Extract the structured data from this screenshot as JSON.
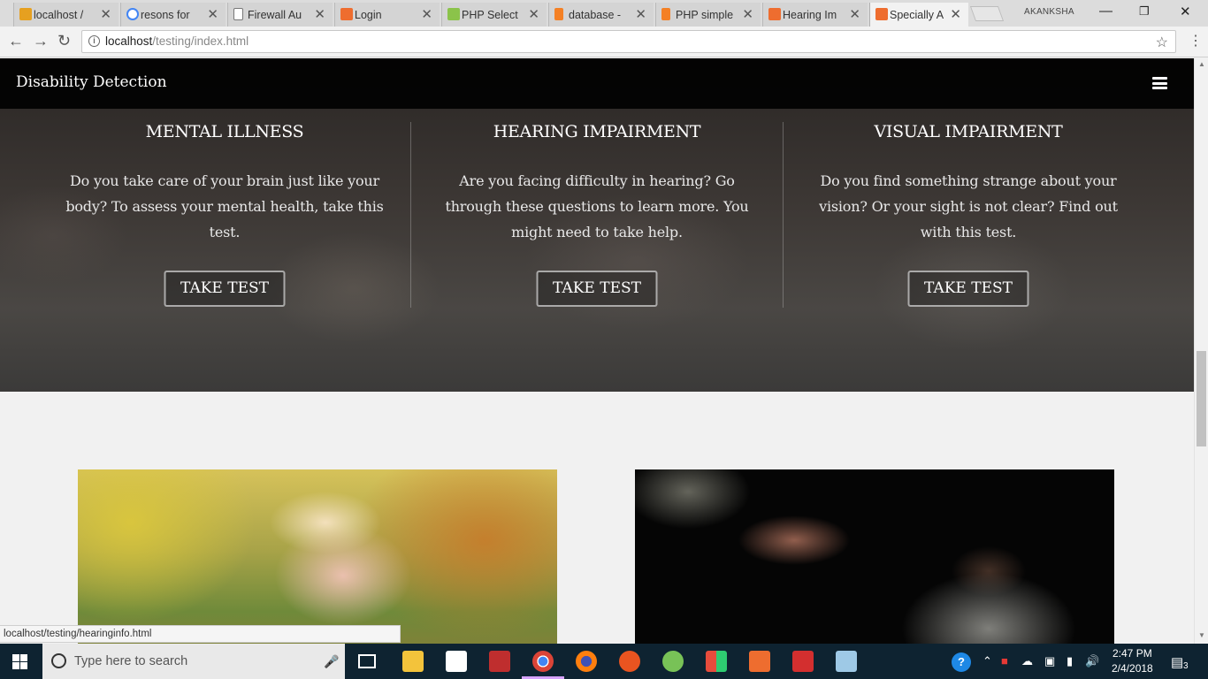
{
  "browser": {
    "tabs": [
      {
        "title": "localhost /",
        "favicon_color": "#e6a020",
        "active": false
      },
      {
        "title": "resons for",
        "favicon_color": "#4285f4",
        "active": false
      },
      {
        "title": "Firewall Au",
        "favicon_color": "#ffffff",
        "active": false
      },
      {
        "title": "Login",
        "favicon_color": "#ee6d2f",
        "active": false
      },
      {
        "title": "PHP Select",
        "favicon_color": "#8bc34a",
        "active": false
      },
      {
        "title": "database -",
        "favicon_color": "#f48024",
        "active": false
      },
      {
        "title": "PHP simple",
        "favicon_color": "#f48024",
        "active": false
      },
      {
        "title": "Hearing Im",
        "favicon_color": "#ee6d2f",
        "active": false
      },
      {
        "title": "Specially A",
        "favicon_color": "#ee6d2f",
        "active": true
      }
    ],
    "tab_close_glyph": "✕",
    "profile_name": "AKANKSHA",
    "address": {
      "host": "localhost",
      "path": "/testing/index.html"
    },
    "status_url": "localhost/testing/hearinginfo.html"
  },
  "site": {
    "brand": "Disability Detection",
    "accent": "#000000",
    "sections": [
      {
        "title": "MENTAL ILLNESS",
        "description": "Do you take care of your brain just like your body? To assess your mental health, take this test.",
        "button": "TAKE TEST"
      },
      {
        "title": "HEARING IMPAIRMENT",
        "description": "Are you facing difficulty in hearing? Go through these questions to learn more. You might need to take help.",
        "button": "TAKE TEST"
      },
      {
        "title": "VISUAL IMPAIRMENT",
        "description": "Do you find something strange about your vision? Or your sight is not clear? Find out with this test.",
        "button": "TAKE TEST"
      }
    ]
  },
  "taskbar": {
    "search_placeholder": "Type here to search",
    "time": "2:47 PM",
    "date": "2/4/2018",
    "notification_count": "3"
  }
}
